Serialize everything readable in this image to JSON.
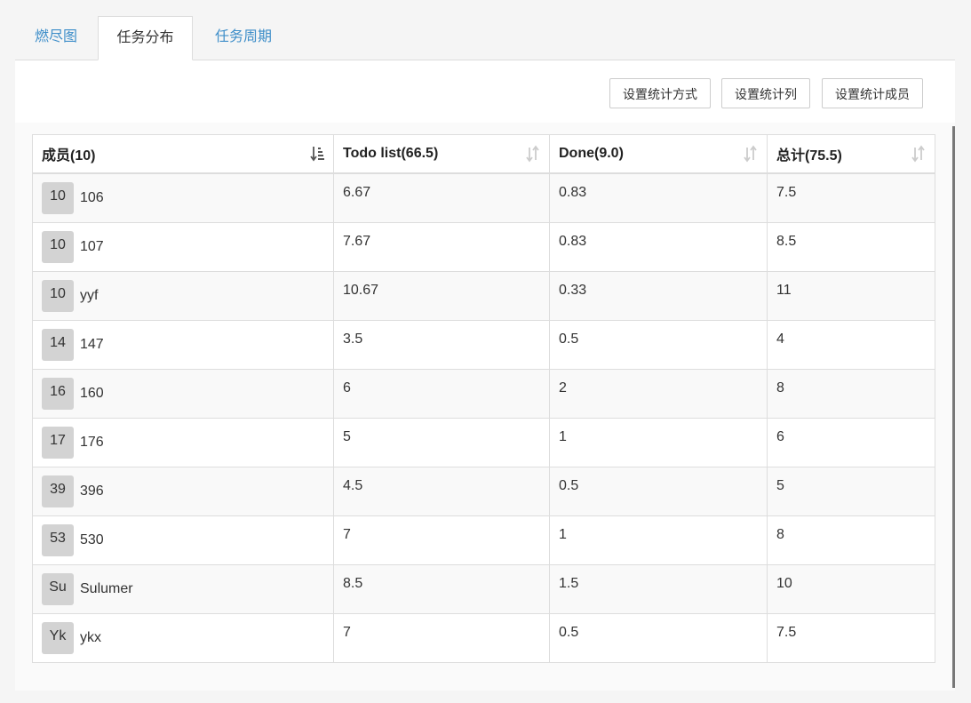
{
  "tabs": [
    {
      "label": "燃尽图",
      "active": false
    },
    {
      "label": "任务分布",
      "active": true
    },
    {
      "label": "任务周期",
      "active": false
    }
  ],
  "toolbar": {
    "set_method_label": "设置统计方式",
    "set_columns_label": "设置统计列",
    "set_members_label": "设置统计成员"
  },
  "table": {
    "headers": [
      "成员(10)",
      "Todo list(66.5)",
      "Done(9.0)",
      "总计(75.5)"
    ],
    "rows": [
      {
        "avatar": "10",
        "name": "106",
        "todo": "6.67",
        "done": "0.83",
        "total": "7.5"
      },
      {
        "avatar": "10",
        "name": "107",
        "todo": "7.67",
        "done": "0.83",
        "total": "8.5"
      },
      {
        "avatar": "10",
        "name": "yyf",
        "todo": "10.67",
        "done": "0.33",
        "total": "11"
      },
      {
        "avatar": "14",
        "name": "147",
        "todo": "3.5",
        "done": "0.5",
        "total": "4"
      },
      {
        "avatar": "16",
        "name": "160",
        "todo": "6",
        "done": "2",
        "total": "8"
      },
      {
        "avatar": "17",
        "name": "176",
        "todo": "5",
        "done": "1",
        "total": "6"
      },
      {
        "avatar": "39",
        "name": "396",
        "todo": "4.5",
        "done": "0.5",
        "total": "5"
      },
      {
        "avatar": "53",
        "name": "530",
        "todo": "7",
        "done": "1",
        "total": "8"
      },
      {
        "avatar": "Su",
        "name": "Sulumer",
        "todo": "8.5",
        "done": "1.5",
        "total": "10"
      },
      {
        "avatar": "Yk",
        "name": "ykx",
        "todo": "7",
        "done": "0.5",
        "total": "7.5"
      }
    ]
  },
  "icons": {
    "sort_active": "sort-descending-icon",
    "sort_default": "sort-both-icon"
  },
  "colors": {
    "link": "#3e8ec9",
    "row_odd": "#f9f9f9",
    "border": "#dddddd"
  }
}
